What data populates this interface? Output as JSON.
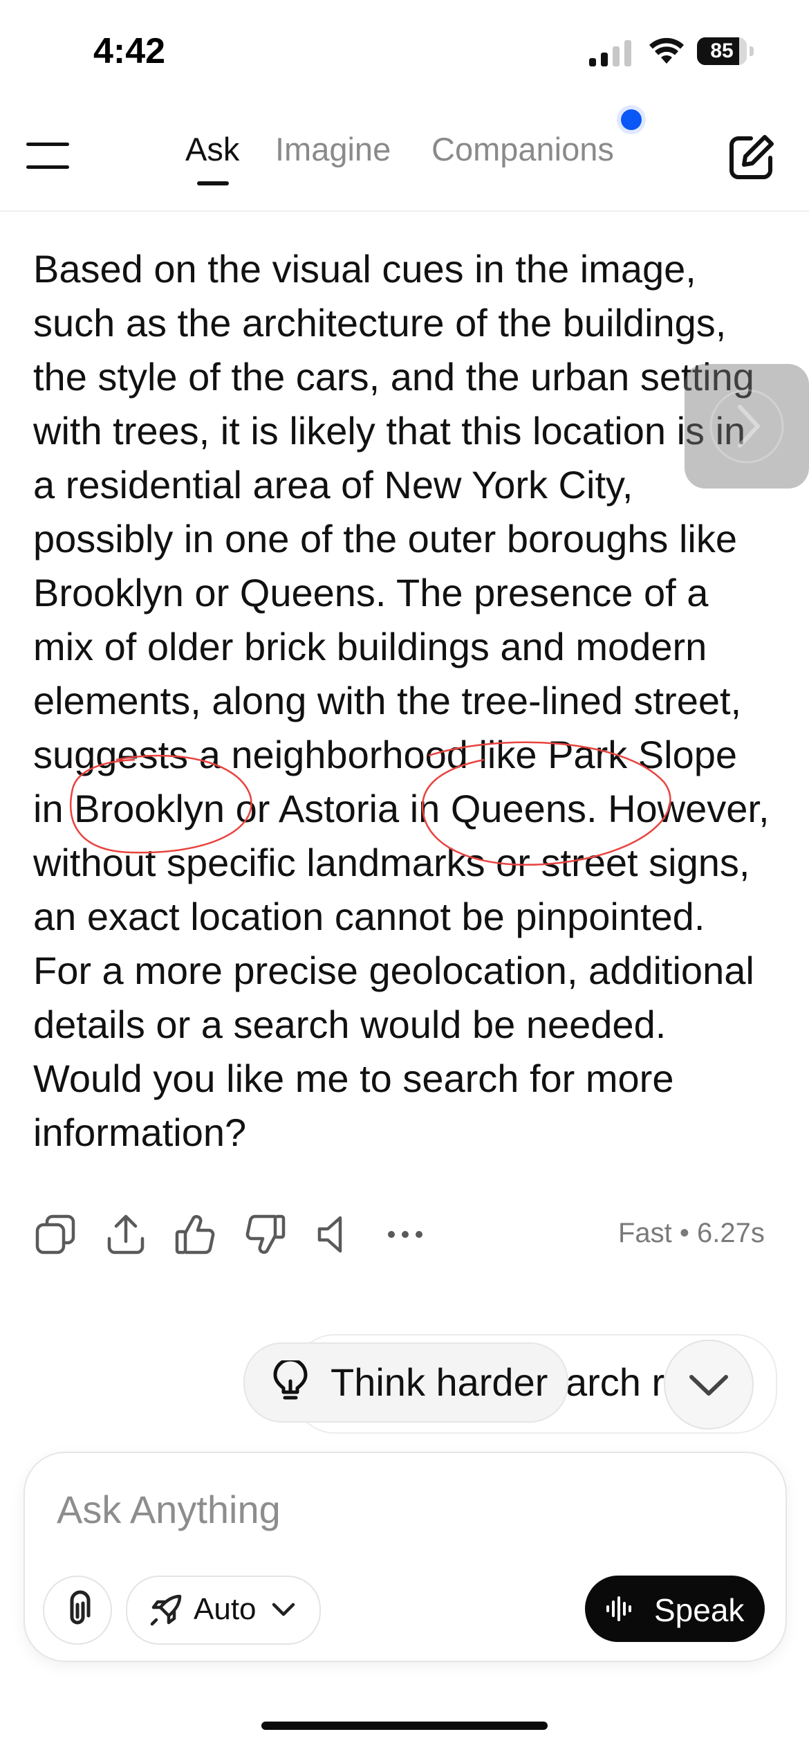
{
  "status_bar": {
    "time": "4:42",
    "battery_percent": "85",
    "battery_level": 0.85,
    "signal_bars": 2
  },
  "header": {
    "tabs": [
      {
        "label": "Ask",
        "active": true
      },
      {
        "label": "Imagine",
        "active": false
      },
      {
        "label": "Companions",
        "active": false,
        "has_notification": true
      }
    ],
    "menu_icon": "hamburger-icon",
    "edit_icon": "edit-icon"
  },
  "message": {
    "text": "Based on the visual cues in the image,\nsuch as the architecture of the buildings,\nthe style of the cars, and the urban setting\nwith trees, it is likely that this location is in\na residential area of New York City,\npossibly in one of the outer boroughs like\nBrooklyn or Queens. The presence of a\nmix of older brick buildings and modern\nelements, along with the tree-lined street,\nsuggests a neighborhood like Park Slope\nin Brooklyn or Astoria in Queens. However,\nwithout specific landmarks or street signs,\nan exact location cannot be pinpointed.\nFor a more precise geolocation, additional\ndetails or a search would be needed.\nWould you like me to search for more\ninformation?",
    "annotation_color": "#e8433f"
  },
  "actions": {
    "icons": [
      "copy-icon",
      "share-icon",
      "thumbs-up-icon",
      "thumbs-down-icon",
      "speaker-icon",
      "more-icon"
    ],
    "meta": "Fast • 6.27s"
  },
  "suggestions": {
    "think_harder": "Think harder",
    "partial_suggestion": "arch r"
  },
  "composer": {
    "placeholder": "Ask Anything",
    "mode_label": "Auto",
    "speak_label": "Speak"
  },
  "colors": {
    "accent_dot": "#0b57f5",
    "speak_bg": "#0a0a0a"
  }
}
